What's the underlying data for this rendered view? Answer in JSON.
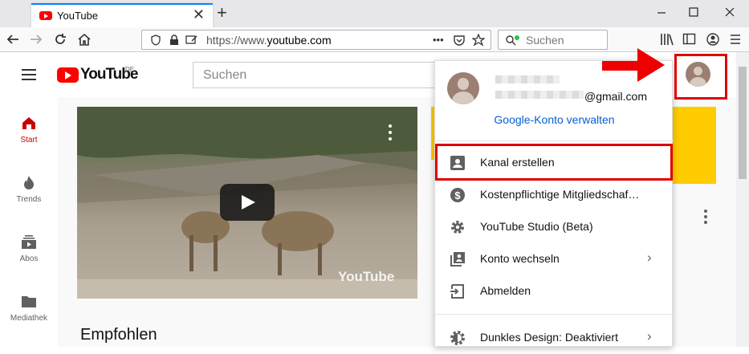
{
  "browser": {
    "tab_title": "YouTube",
    "tab_close": "✕",
    "new_tab": "+",
    "url_prefix": "https://www.",
    "url_domain": "youtube.com",
    "url_more": "•••",
    "search_placeholder": "Suchen"
  },
  "header": {
    "logo_text": "YouTube",
    "logo_region": "DE",
    "search_placeholder": "Suchen"
  },
  "sidebar": {
    "items": [
      {
        "label": "Start"
      },
      {
        "label": "Trends"
      },
      {
        "label": "Abos"
      },
      {
        "label": "Mediathek"
      }
    ]
  },
  "main": {
    "video_watermark": "YouTube",
    "section_title": "Empfohlen"
  },
  "account_menu": {
    "email_suffix": "@gmail.com",
    "manage_link": "Google-Konto verwalten",
    "items": [
      {
        "label": "Kanal erstellen",
        "icon": "person-box-icon"
      },
      {
        "label": "Kostenpflichtige Mitgliedschaf…",
        "icon": "dollar-icon"
      },
      {
        "label": "YouTube Studio (Beta)",
        "icon": "gear-icon"
      },
      {
        "label": "Konto wechseln",
        "icon": "switch-account-icon",
        "chevron": "›"
      },
      {
        "label": "Abmelden",
        "icon": "sign-out-icon"
      },
      {
        "label": "Dunkles Design: Deaktiviert",
        "icon": "dark-theme-icon",
        "chevron": "›"
      }
    ]
  },
  "colors": {
    "youtube_red": "#ff0000",
    "highlight_red": "#e00000",
    "link_blue": "#065fd4",
    "accent_yellow": "#ffcc00"
  }
}
